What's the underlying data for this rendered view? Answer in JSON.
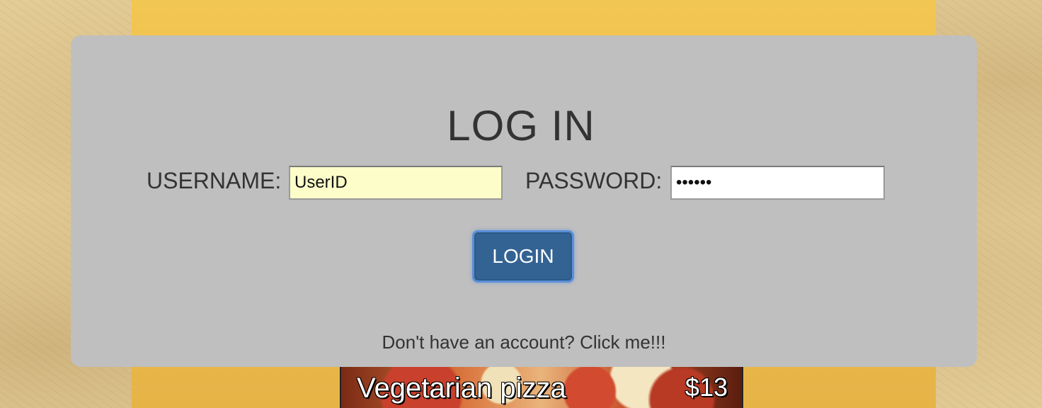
{
  "login": {
    "title": "LOG IN",
    "username_label": "USERNAME:",
    "username_value": "UserID",
    "password_label": "PASSWORD:",
    "password_value": "123456",
    "login_button": "LOGIN",
    "signup_link": "Don't have an account? Click me!!!"
  },
  "menu_item": {
    "name": "Vegetarian pizza",
    "price": "$13"
  },
  "colors": {
    "column": "#f2c653",
    "panel": "#bfbfbf",
    "button": "#336393",
    "username_field": "#fdfdc9"
  }
}
